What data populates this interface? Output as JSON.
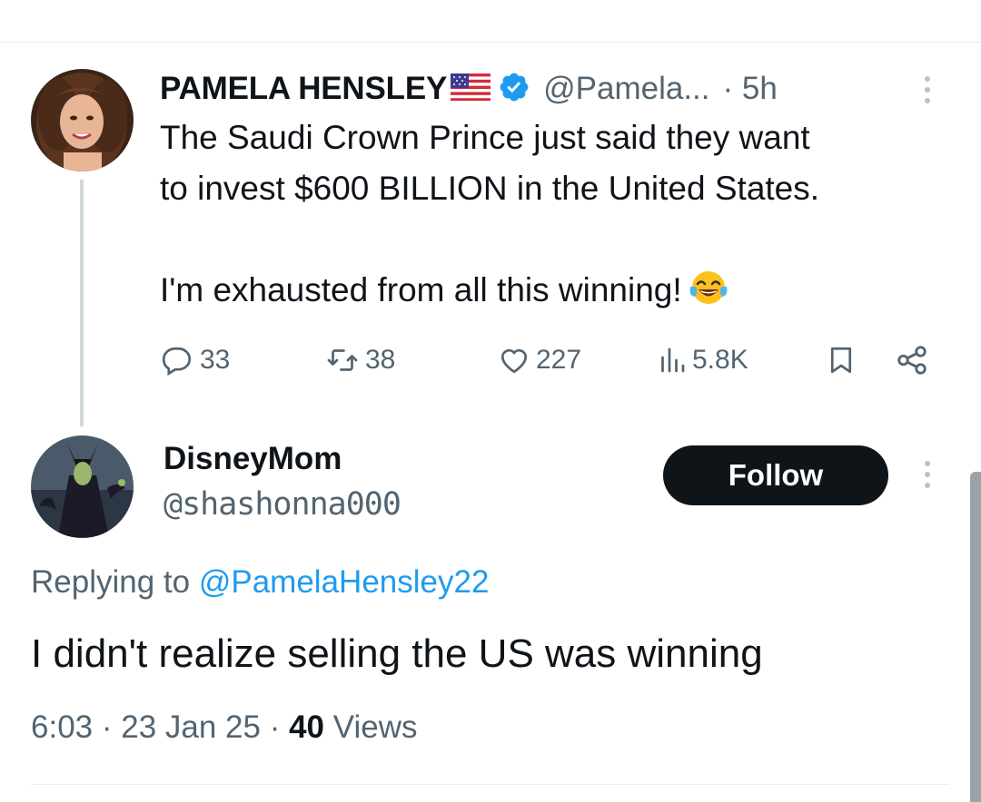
{
  "original_tweet": {
    "author_name": "PAMELA HENSLEY",
    "flag_icon": "us-flag-icon",
    "verified_icon": "verified-badge-icon",
    "handle": "@Pamela...",
    "time": "· 5h",
    "text_line1": "The Saudi Crown Prince just said they want",
    "text_line2": "to invest $600 BILLION in the United States.",
    "text_line3": "I'm exhausted from all this winning!",
    "emoji": "face-with-tears-of-joy",
    "actions": {
      "replies": "33",
      "retweets": "38",
      "likes": "227",
      "views": "5.8K"
    }
  },
  "reply_tweet": {
    "author_name": "DisneyMom",
    "handle": "@shashonna000",
    "follow_label": "Follow",
    "replying_prefix": "Replying to",
    "replying_handle": "@PamelaHensley22",
    "text": "I didn't realize selling the US was winning",
    "timestamp": "6:03 · 23 Jan 25 · ",
    "views_count": "40",
    "views_label": " Views"
  },
  "colors": {
    "text_primary": "#0f1419",
    "text_secondary": "#536471",
    "link": "#1d9bf0",
    "verified": "#1d9bf0",
    "divider": "#e6ecf0"
  }
}
